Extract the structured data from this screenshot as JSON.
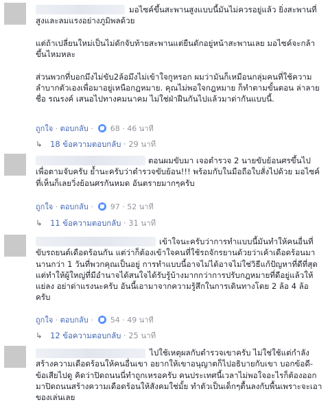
{
  "comments": [
    {
      "text": "มอไซค์ขึ้นสะพานสูงแบบนี้มันไม่ควรอยู่แล้ว ยิ่งสะพานที่สูงและลมแรงอย่างภูมิพลด้วย\n\nแต่ถ้าเปลี่ยนใหม่เป็นไม่ดักจับท้ายสะพานแต่ยืนดักอยู่หน้าสะพานเลย มอไซค์จะกล้าขึ้นไหมหละ\n\nส่วนพวกที่บอกมึงไม่ขับ2ล้อมึงไม่เข้าใจกูหรอก ผมว่ามันก็เหมือนกลุ่มคนที่ใช้ความลำบากตัวเองเพื่อมาอยู่เหนือกฎหมาย. คุณไม่พอใจกฎหมาย ก็ทำตามขั้นตอน ล่าลายชื่อ รณรงค์ เสนอไปทางคมนาคม ไม่ใช่ฝ่าฝืนกันไปแล้วมาด่ากันแบบนี้.",
      "like": "ถูกใจ",
      "reply": "ตอบกลับ",
      "likes": "68",
      "time": "46 นาที",
      "replies_label": "18 ข้อความตอบกลับ",
      "replies_time": "29 นาที"
    },
    {
      "text": "ตอนผมขับมา เจอตำรวจ 2 นายขับย้อนศรขึ้นไปเพื่อตามจับครับ ย้ำนะครับว่าตำรวจขับย้อน!!! พร้อมกับในมือถือใบสั่งไปด้วย มอไซค์ที่เห็นก็เลยวิ่งย้อนศรกันหมด อันตรายมากๆครับ",
      "like": "ถูกใจ",
      "reply": "ตอบกลับ",
      "likes": "97",
      "time": "52 นาที",
      "replies_label": "11 ข้อความตอบกลับ",
      "replies_time": "31 นาที"
    },
    {
      "text": "เข้าใจนะครับว่าการทำแบบนี้มันทำให้คนอื่นที่ขับรถยนต์เดือดร้อนกัน แต่ว่าก็ต้องเข้าใจคนที่ใช้รถจักรยานด้วยว่าเค้าเดือดร้อนมานานกว่า 1 วันที่พวกคุณเป็นอยู่ การทำแบบนี้อาจไม่ได้อาจไม่ใช่วิธีแก้ปัญหาที่ดีที่สุดแต่ทำให้ผู้ใหญ่ที่มีอำนาจได้สนใจได้รับรู้บ้างมากกว่าการปรับกฎหมายที่ดีอยู่แล้วให้แย่ลง อย่าด่าแรงนะครับ อันนี้เอามาจากความรู้สึกในการเดินทางโดย 2 ล้อ 4 ล้อครับ",
      "like": "ถูกใจ",
      "reply": "ตอบกลับ",
      "likes": "54",
      "time": "49 นาที",
      "replies_label": "12 ข้อความตอบกลับ",
      "replies_time": "25 นาที"
    },
    {
      "text": "ไปใช้เหตุผลกับตำรวจเขาครับ ไม่ใช่ใช้แต่กำลังสร้างความเดือดร้อนให้คนอื่นเขา อยากให้เขาอนุญาตก็ไปอธิบายกับเขา บอกข้อดี-ข้อเสียไปดู คิดว่าปิดถนนนี่ทำถูกเหรอครับ คนประเทศนี้เวลาไม่พอใจอะไรก็ต้องออกมาปิดถนนสร้างความเดือดร้อนให้สังคมใช่มั้ย ทำตัวเป็นเด็กๆตื้นลงกับพื้นเพราะจะเอาของเล่นเลย"
    }
  ],
  "ui": {
    "like_icon": "thumbs-up-icon",
    "reply_arrow_icon": "reply-arrow-icon",
    "like_color": "#5890ff",
    "link_color": "#4267b2"
  }
}
